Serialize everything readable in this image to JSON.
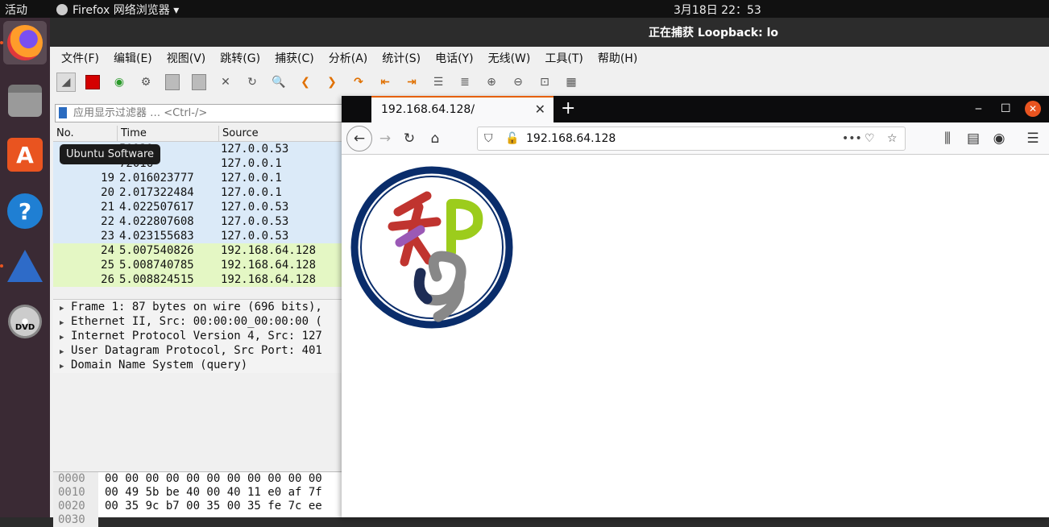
{
  "topbar": {
    "activities": "活动",
    "app_menu": "Firefox 网络浏览器 ▾",
    "clock": "3月18日  22：53"
  },
  "dock": {
    "tooltip": "Ubuntu Software",
    "dvd_label": "DVD"
  },
  "wireshark": {
    "title": "正在捕获 Loopback: lo",
    "menu": [
      "文件(F)",
      "编辑(E)",
      "视图(V)",
      "跳转(G)",
      "捕获(C)",
      "分析(A)",
      "统计(S)",
      "电话(Y)",
      "无线(W)",
      "工具(T)",
      "帮助(H)"
    ],
    "filter_placeholder": "应用显示过滤器 … <Ctrl-/>",
    "columns": {
      "no": "No.",
      "time": "Time",
      "source": "Source"
    },
    "packets": [
      {
        "no": "",
        "time": "50939",
        "source": "127.0.0.53",
        "color": "blue"
      },
      {
        "no": "",
        "time": "72016",
        "source": "127.0.0.1",
        "color": "blue"
      },
      {
        "no": "19",
        "time": "2.016023777",
        "source": "127.0.0.1",
        "color": "blue"
      },
      {
        "no": "20",
        "time": "2.017322484",
        "source": "127.0.0.1",
        "color": "blue"
      },
      {
        "no": "21",
        "time": "4.022507617",
        "source": "127.0.0.53",
        "color": "blue"
      },
      {
        "no": "22",
        "time": "4.022807608",
        "source": "127.0.0.53",
        "color": "blue"
      },
      {
        "no": "23",
        "time": "4.023155683",
        "source": "127.0.0.53",
        "color": "blue"
      },
      {
        "no": "24",
        "time": "5.007540826",
        "source": "192.168.64.128",
        "color": "green"
      },
      {
        "no": "25",
        "time": "5.008740785",
        "source": "192.168.64.128",
        "color": "green"
      },
      {
        "no": "26",
        "time": "5.008824515",
        "source": "192.168.64.128",
        "color": "green"
      }
    ],
    "details": [
      "Frame 1: 87 bytes on wire (696 bits),",
      "Ethernet II, Src: 00:00:00_00:00:00 (",
      "Internet Protocol Version 4, Src: 127",
      "User Datagram Protocol, Src Port: 401",
      "Domain Name System (query)"
    ],
    "hex": [
      {
        "offset": "0000",
        "bytes": "00 00 00 00 00 00 00 00  00 00 00"
      },
      {
        "offset": "0010",
        "bytes": "00 49 5b be 40 00 40 11  e0 af 7f"
      },
      {
        "offset": "0020",
        "bytes": "00 35 9c b7 00 35 00 35  fe 7c ee"
      },
      {
        "offset": "0030",
        "bytes": ""
      }
    ]
  },
  "firefox": {
    "tab_title": "192.168.64.128/",
    "url": "192.168.64.128"
  }
}
